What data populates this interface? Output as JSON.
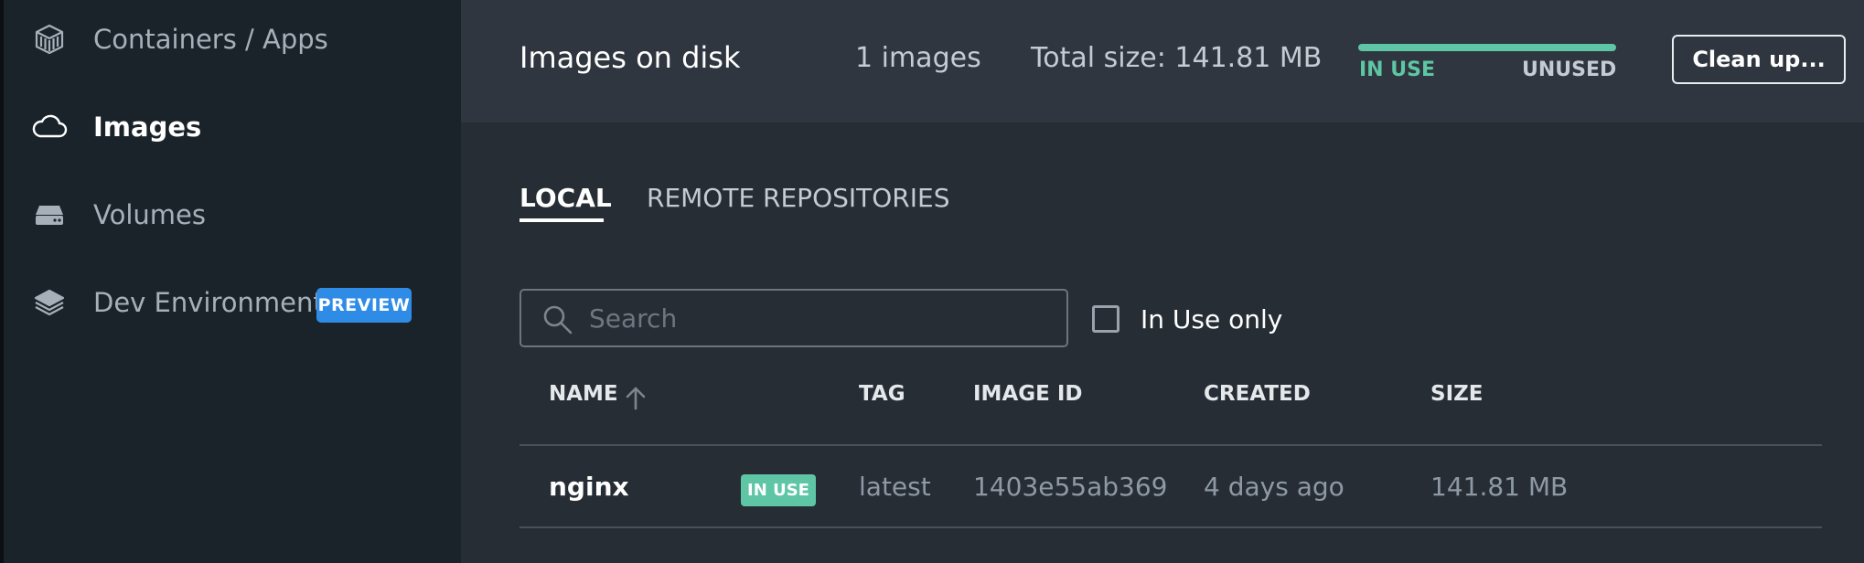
{
  "sidebar": {
    "items": [
      {
        "label": "Containers / Apps",
        "icon": "containers-icon"
      },
      {
        "label": "Images",
        "icon": "cloud-icon",
        "active": true
      },
      {
        "label": "Volumes",
        "icon": "volume-icon"
      },
      {
        "label": "Dev Environments",
        "icon": "dev-environments-icon",
        "badge": "PREVIEW"
      }
    ]
  },
  "header": {
    "title": "Images on disk",
    "image_count": "1 images",
    "total_size": "Total size: 141.81 MB",
    "usage": {
      "in_use_label": "IN USE",
      "unused_label": "UNUSED",
      "in_use_fraction": 1.0
    },
    "cleanup_label": "Clean up..."
  },
  "tabs": [
    {
      "label": "LOCAL",
      "active": true
    },
    {
      "label": "REMOTE REPOSITORIES",
      "active": false
    }
  ],
  "filters": {
    "search_placeholder": "Search",
    "search_value": "",
    "in_use_only_label": "In Use only",
    "in_use_only_checked": false
  },
  "table": {
    "columns": [
      "NAME",
      "TAG",
      "IMAGE ID",
      "CREATED",
      "SIZE"
    ],
    "sort": {
      "column": "NAME",
      "direction": "ascending"
    },
    "rows": [
      {
        "name": "nginx",
        "badge": "IN USE",
        "tag": "latest",
        "image_id": "1403e55ab369",
        "created": "4 days ago",
        "size": "141.81 MB"
      }
    ]
  },
  "colors": {
    "accent_green": "#5ec6a4",
    "preview_blue": "#2f8ce6",
    "sidebar_bg": "#1b232a",
    "main_bg": "#262d35",
    "topbar_bg": "#2f363f"
  }
}
